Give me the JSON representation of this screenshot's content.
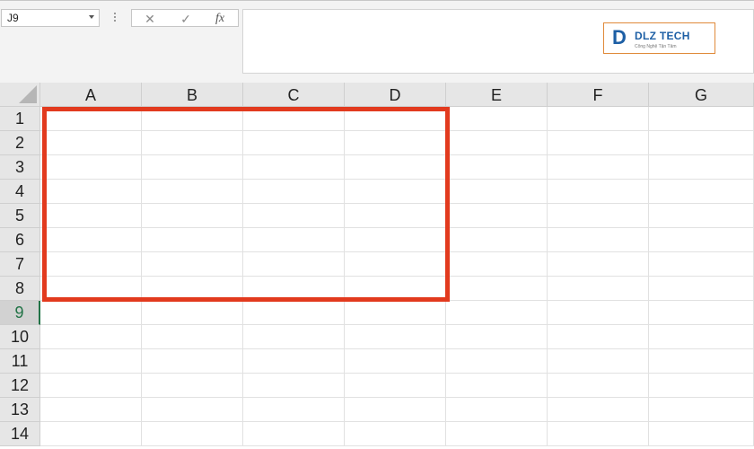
{
  "namebox": {
    "value": "J9"
  },
  "formula_buttons": {
    "cancel_icon": "✕",
    "enter_icon": "✓",
    "fx_label": "fx"
  },
  "logo": {
    "mark": "D",
    "name": "DLZ TECH",
    "tagline": "Công Nghệ Tận Tâm"
  },
  "columns": [
    "A",
    "B",
    "C",
    "D",
    "E",
    "F",
    "G"
  ],
  "rows": [
    "1",
    "2",
    "3",
    "4",
    "5",
    "6",
    "7",
    "8",
    "9",
    "10",
    "11",
    "12",
    "13",
    "14"
  ],
  "active_row": "9",
  "highlight_color": "#e23a1e"
}
